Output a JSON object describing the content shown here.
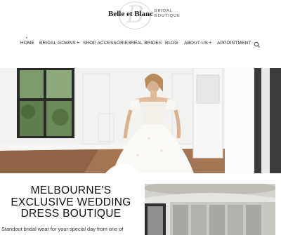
{
  "brand": {
    "name": "Belle et Blanc",
    "subtitle_line1": "BRIDAL",
    "subtitle_line2": "BOUTIQUE"
  },
  "nav": {
    "items": [
      {
        "label": "HOME",
        "has_submenu": false
      },
      {
        "label": "BRIDAL GOWNS",
        "has_submenu": true
      },
      {
        "label": "SHOP ACCESSORIES",
        "has_submenu": false
      },
      {
        "label": "REAL BRIDES",
        "has_submenu": false
      },
      {
        "label": "BLOG",
        "has_submenu": false
      },
      {
        "label": "ABOUT US",
        "has_submenu": true
      },
      {
        "label": "APPOINTMENT",
        "has_submenu": false
      }
    ],
    "submenu_marker": "+",
    "active_marker": "•",
    "search_icon": "search-icon"
  },
  "hero": {
    "image": "bride-in-ballgown-showroom"
  },
  "intro": {
    "title_line1": "MELBOURNE'S",
    "title_line2": "EXCLUSIVE WEDDING",
    "title_line3": "DRESS BOUTIQUE",
    "body": "Standout bridal wear for your special day from one of"
  },
  "colors": {
    "text": "#222222",
    "background": "#ffffff"
  }
}
